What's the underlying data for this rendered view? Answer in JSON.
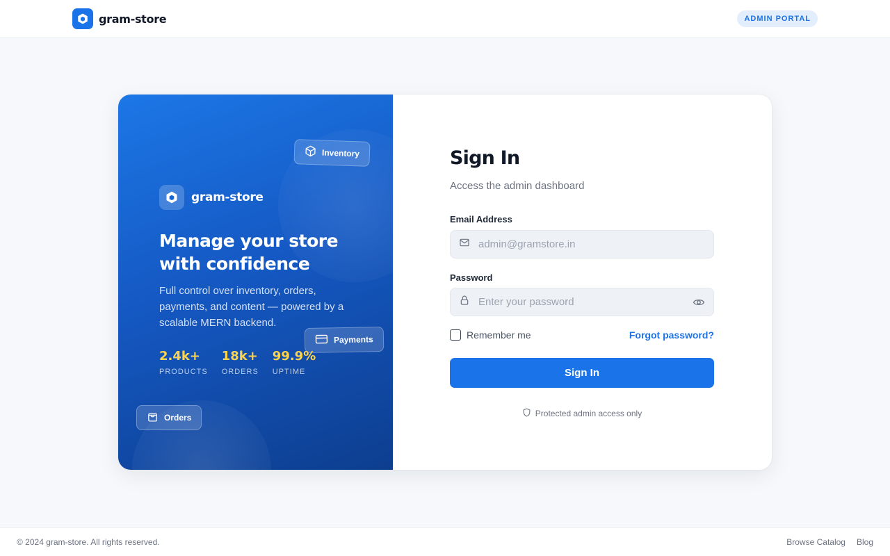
{
  "header": {
    "brand_name": "gram-store",
    "badge": "ADMIN PORTAL"
  },
  "hero": {
    "brand_name": "gram-store",
    "title": "Manage your store with confidence",
    "description": "Full control over inventory, orders, payments, and content — powered by a scalable MERN backend.",
    "chips": {
      "inventory": "Inventory",
      "payments": "Payments",
      "orders": "Orders"
    },
    "stats": [
      {
        "value": "2.4k+",
        "label": "PRODUCTS"
      },
      {
        "value": "18k+",
        "label": "ORDERS"
      },
      {
        "value": "99.9%",
        "label": "UPTIME"
      }
    ]
  },
  "form": {
    "title": "Sign In",
    "subtitle": "Access the admin dashboard",
    "email": {
      "label": "Email Address",
      "placeholder": "admin@gramstore.in",
      "value": ""
    },
    "password": {
      "label": "Password",
      "placeholder": "Enter your password",
      "value": ""
    },
    "remember_label": "Remember me",
    "remember_checked": false,
    "forgot_label": "Forgot password?",
    "submit_label": "Sign In",
    "security_note": "Protected admin access only"
  },
  "footer": {
    "copyright": "© 2024 gram-store. All rights reserved.",
    "links": [
      "Browse Catalog",
      "Blog"
    ]
  },
  "colors": {
    "primary": "#1a73e8",
    "stat_accent": "#fcd34d",
    "page_background": "#f6f8fb"
  },
  "icons": {
    "brand": "hexagon-logo-icon",
    "email": "mail-icon",
    "password": "lock-icon",
    "toggle_password": "eye-icon",
    "security": "shield-icon",
    "inventory": "box-icon",
    "payments": "credit-card-icon",
    "orders": "shopping-bag-icon"
  }
}
